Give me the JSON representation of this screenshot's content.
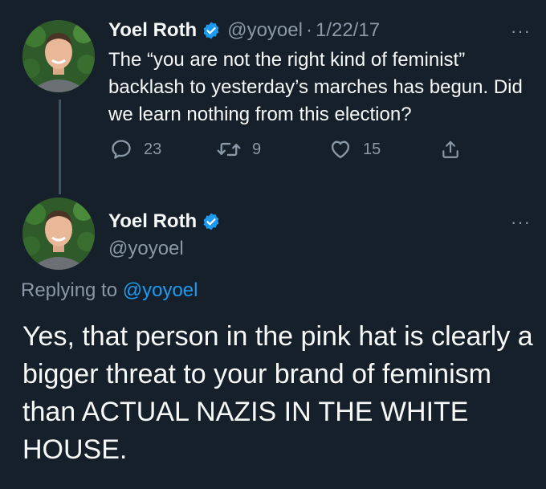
{
  "tweet1": {
    "author_name": "Yoel Roth",
    "handle": "@yoyoel",
    "separator": "·",
    "date": "1/22/17",
    "text": "The “you are not the right kind of feminist” backlash to yesterday’s marches has begun. Did we learn nothing from this election?",
    "reply_count": "23",
    "retweet_count": "9",
    "like_count": "15",
    "more_label": "···"
  },
  "tweet2": {
    "author_name": "Yoel Roth",
    "handle": "@yoyoel",
    "replying_prefix": "Replying to",
    "replying_to": "@yoyoel",
    "text": "Yes, that person in the pink hat is clearly a bigger threat to your brand of feminism than ACTUAL NAZIS IN THE WHITE HOUSE.",
    "more_label": "···"
  },
  "colors": {
    "background": "#15202b",
    "text": "#f7f9f9",
    "muted": "#8b98a5",
    "accent": "#1d9bf0",
    "thread_line": "#3d5466"
  },
  "icons": [
    "verified-badge-icon",
    "reply-icon",
    "retweet-icon",
    "like-icon",
    "share-icon",
    "more-icon"
  ]
}
